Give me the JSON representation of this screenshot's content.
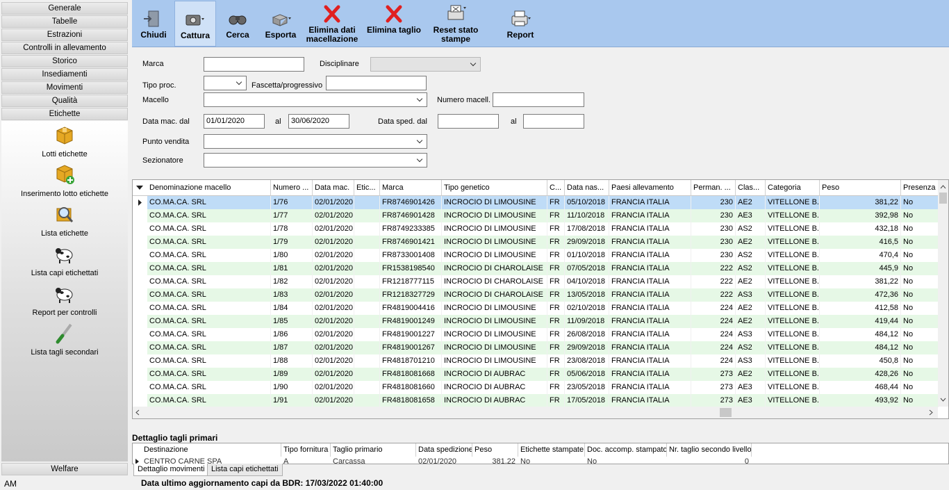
{
  "sidebar": {
    "groups": [
      "Generale",
      "Tabelle",
      "Estrazioni",
      "Controlli in allevamento",
      "Storico",
      "Insediamenti",
      "Movimenti",
      "Qualità",
      "Etichette"
    ],
    "items": [
      {
        "label": "Lotti etichette",
        "icon": "box-icon"
      },
      {
        "label": "Inserimento lotto etichette",
        "icon": "box-add-icon"
      },
      {
        "label": "Lista etichette",
        "icon": "magnifier-icon"
      },
      {
        "label": "Lista capi etichettati",
        "icon": "cow-icon"
      },
      {
        "label": "Report per controlli",
        "icon": "cow-icon"
      },
      {
        "label": "Lista tagli secondari",
        "icon": "knife-icon"
      }
    ],
    "bottom_group": "Welfare",
    "status_left": "AM"
  },
  "toolbar": {
    "buttons": [
      {
        "label": "Chiudi",
        "icon": "close-door-icon"
      },
      {
        "label": "Cattura",
        "icon": "camera-icon"
      },
      {
        "label": "Cerca",
        "icon": "binoculars-icon"
      },
      {
        "label": "Esporta",
        "icon": "export-icon"
      },
      {
        "label": "Elimina dati macellazione",
        "icon": "red-x-icon"
      },
      {
        "label": "Elimina taglio",
        "icon": "red-x-icon"
      },
      {
        "label": "Reset stato stampe",
        "icon": "printer-reset-icon"
      },
      {
        "label": "Report",
        "icon": "printer-icon"
      }
    ]
  },
  "filters": {
    "marca_label": "Marca",
    "marca_value": "",
    "disciplinare_label": "Disciplinare",
    "disciplinare_value": "",
    "tipo_proc_label": "Tipo proc.",
    "tipo_proc_value": "",
    "fascetta_label": "Fascetta/progressivo",
    "fascetta_value": "",
    "macello_label": "Macello",
    "macello_value": "",
    "numero_macell_label": "Numero macell.",
    "numero_macell_value": "",
    "data_mac_label": "Data mac. dal",
    "data_mac_from": "01/01/2020",
    "al_label": "al",
    "data_mac_to": "30/06/2020",
    "data_sped_label": "Data sped. dal",
    "data_sped_from": "",
    "data_sped_to": "",
    "punto_vendita_label": "Punto vendita",
    "punto_vendita_value": "",
    "sezionatore_label": "Sezionatore",
    "sezionatore_value": ""
  },
  "grid": {
    "columns": [
      "Denominazione macello",
      "Numero ...",
      "Data mac.",
      "Etic...",
      "Marca",
      "Tipo genetico",
      "C...",
      "Data nas...",
      "Paesi allevamento",
      "Perman. ...",
      "Clas...",
      "Categoria",
      "Peso",
      "Presenza"
    ],
    "rows": [
      [
        "CO.MA.CA. SRL",
        "1/76",
        "02/01/2020",
        "",
        "FR8746901426",
        "INCROCIO DI LIMOUSINE",
        "FR",
        "05/10/2018",
        "FRANCIA ITALIA",
        "230",
        "AE2",
        "VITELLONE B...",
        "381,22",
        "No"
      ],
      [
        "CO.MA.CA. SRL",
        "1/77",
        "02/01/2020",
        "",
        "FR8746901428",
        "INCROCIO DI LIMOUSINE",
        "FR",
        "11/10/2018",
        "FRANCIA ITALIA",
        "230",
        "AE3",
        "VITELLONE B...",
        "392,98",
        "No"
      ],
      [
        "CO.MA.CA. SRL",
        "1/78",
        "02/01/2020",
        "",
        "FR8749233385",
        "INCROCIO DI LIMOUSINE",
        "FR",
        "17/08/2018",
        "FRANCIA ITALIA",
        "230",
        "AS2",
        "VITELLONE B...",
        "432,18",
        "No"
      ],
      [
        "CO.MA.CA. SRL",
        "1/79",
        "02/01/2020",
        "",
        "FR8746901421",
        "INCROCIO DI LIMOUSINE",
        "FR",
        "29/09/2018",
        "FRANCIA ITALIA",
        "230",
        "AE2",
        "VITELLONE B...",
        "416,5",
        "No"
      ],
      [
        "CO.MA.CA. SRL",
        "1/80",
        "02/01/2020",
        "",
        "FR8733001408",
        "INCROCIO DI LIMOUSINE",
        "FR",
        "01/10/2018",
        "FRANCIA ITALIA",
        "230",
        "AS2",
        "VITELLONE B...",
        "470,4",
        "No"
      ],
      [
        "CO.MA.CA. SRL",
        "1/81",
        "02/01/2020",
        "",
        "FR1538198540",
        "INCROCIO DI CHAROLAISE",
        "FR",
        "07/05/2018",
        "FRANCIA ITALIA",
        "222",
        "AS2",
        "VITELLONE B...",
        "445,9",
        "No"
      ],
      [
        "CO.MA.CA. SRL",
        "1/82",
        "02/01/2020",
        "",
        "FR1218777115",
        "INCROCIO DI CHAROLAISE",
        "FR",
        "04/10/2018",
        "FRANCIA ITALIA",
        "222",
        "AE2",
        "VITELLONE B...",
        "381,22",
        "No"
      ],
      [
        "CO.MA.CA. SRL",
        "1/83",
        "02/01/2020",
        "",
        "FR1218327729",
        "INCROCIO DI CHAROLAISE",
        "FR",
        "13/05/2018",
        "FRANCIA ITALIA",
        "222",
        "AS3",
        "VITELLONE B...",
        "472,36",
        "No"
      ],
      [
        "CO.MA.CA. SRL",
        "1/84",
        "02/01/2020",
        "",
        "FR4819004416",
        "INCROCIO DI LIMOUSINE",
        "FR",
        "02/10/2018",
        "FRANCIA ITALIA",
        "224",
        "AE2",
        "VITELLONE B...",
        "412,58",
        "No"
      ],
      [
        "CO.MA.CA. SRL",
        "1/85",
        "02/01/2020",
        "",
        "FR4819001249",
        "INCROCIO DI LIMOUSINE",
        "FR",
        "11/09/2018",
        "FRANCIA ITALIA",
        "224",
        "AE2",
        "VITELLONE B...",
        "419,44",
        "No"
      ],
      [
        "CO.MA.CA. SRL",
        "1/86",
        "02/01/2020",
        "",
        "FR4819001227",
        "INCROCIO DI LIMOUSINE",
        "FR",
        "26/08/2018",
        "FRANCIA ITALIA",
        "224",
        "AS3",
        "VITELLONE B...",
        "484,12",
        "No"
      ],
      [
        "CO.MA.CA. SRL",
        "1/87",
        "02/01/2020",
        "",
        "FR4819001267",
        "INCROCIO DI LIMOUSINE",
        "FR",
        "29/09/2018",
        "FRANCIA ITALIA",
        "224",
        "AS2",
        "VITELLONE B...",
        "484,12",
        "No"
      ],
      [
        "CO.MA.CA. SRL",
        "1/88",
        "02/01/2020",
        "",
        "FR4818701210",
        "INCROCIO DI LIMOUSINE",
        "FR",
        "23/08/2018",
        "FRANCIA ITALIA",
        "224",
        "AS3",
        "VITELLONE B...",
        "450,8",
        "No"
      ],
      [
        "CO.MA.CA. SRL",
        "1/89",
        "02/01/2020",
        "",
        "FR4818081668",
        "INCROCIO DI AUBRAC",
        "FR",
        "05/06/2018",
        "FRANCIA ITALIA",
        "273",
        "AE2",
        "VITELLONE B...",
        "428,26",
        "No"
      ],
      [
        "CO.MA.CA. SRL",
        "1/90",
        "02/01/2020",
        "",
        "FR4818081660",
        "INCROCIO DI AUBRAC",
        "FR",
        "23/05/2018",
        "FRANCIA ITALIA",
        "273",
        "AE3",
        "VITELLONE B...",
        "468,44",
        "No"
      ],
      [
        "CO.MA.CA. SRL",
        "1/91",
        "02/01/2020",
        "",
        "FR4818081658",
        "INCROCIO DI AUBRAC",
        "FR",
        "17/05/2018",
        "FRANCIA ITALIA",
        "273",
        "AE3",
        "VITELLONE B...",
        "493,92",
        "No"
      ]
    ]
  },
  "detail": {
    "title": "Dettaglio tagli primari",
    "columns": [
      "Destinazione",
      "Tipo fornitura",
      "Taglio primario",
      "Data spedizione",
      "Peso",
      "Etichette stampate",
      "Doc. accomp. stampato",
      "Nr. taglio secondo livello"
    ],
    "row": [
      "CENTRO CARNE SPA",
      "A",
      "Carcassa",
      "02/01/2020",
      "381,22",
      "No",
      "No",
      "0"
    ]
  },
  "tabs": [
    "Dettaglio movimenti",
    "Lista capi etichettati"
  ],
  "status": {
    "text": "Data ultimo aggiornamento capi da BDR: 17/03/2022 01:40:00"
  }
}
